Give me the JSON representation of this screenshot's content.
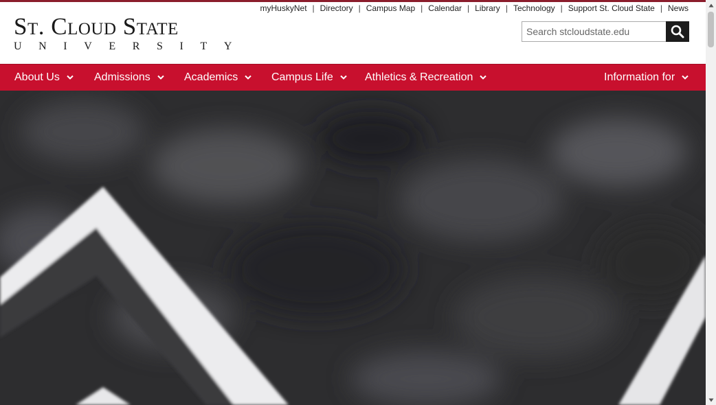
{
  "logo": {
    "line1": "St. Cloud State",
    "line2": "UNIVERSITY"
  },
  "utility_nav": [
    {
      "label": "myHuskyNet"
    },
    {
      "label": "Directory"
    },
    {
      "label": "Campus Map"
    },
    {
      "label": "Calendar"
    },
    {
      "label": "Library"
    },
    {
      "label": "Technology"
    },
    {
      "label": "Support St. Cloud State"
    },
    {
      "label": "News"
    }
  ],
  "search": {
    "placeholder": "Search stcloudstate.edu",
    "value": "",
    "icon": "search-icon"
  },
  "main_nav": [
    {
      "label": "About Us",
      "icon": "chevron-down-icon"
    },
    {
      "label": "Admissions",
      "icon": "chevron-down-icon"
    },
    {
      "label": "Academics",
      "icon": "chevron-down-icon"
    },
    {
      "label": "Campus Life",
      "icon": "chevron-down-icon"
    },
    {
      "label": "Athletics & Recreation",
      "icon": "chevron-down-icon"
    },
    {
      "label": "Information for",
      "icon": "chevron-down-icon"
    }
  ],
  "colors": {
    "accent_red": "#c8102e",
    "dark_accent": "#8b1d2c",
    "search_button": "#1c1c1c"
  }
}
